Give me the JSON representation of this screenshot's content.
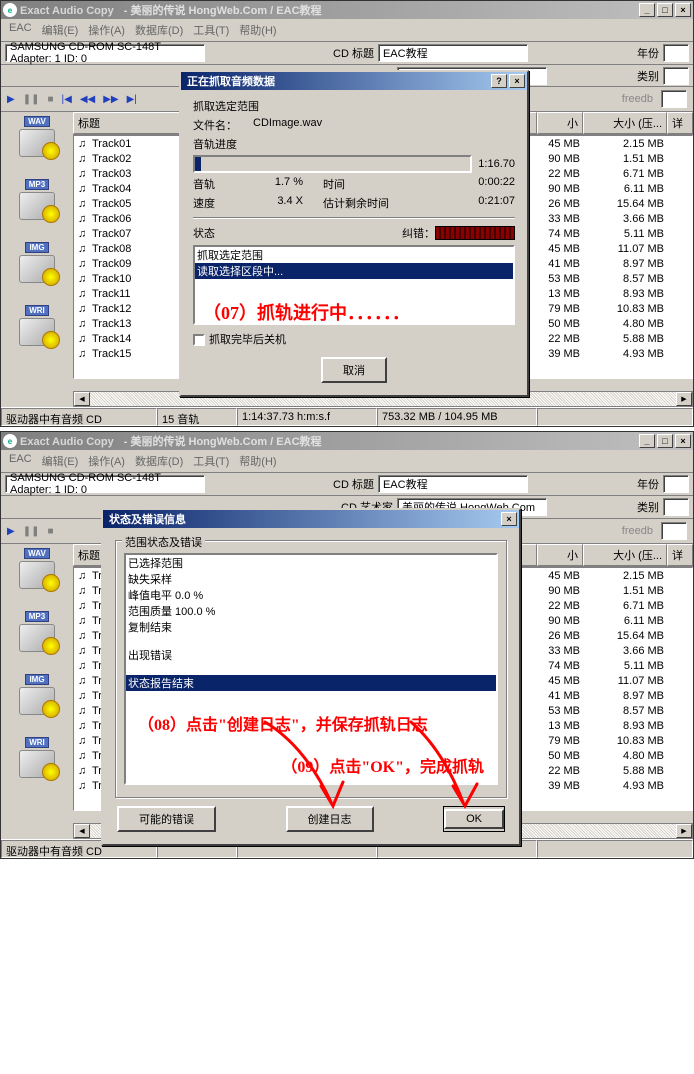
{
  "win1": {
    "title": "Exact Audio Copy",
    "subtitle": "- 美丽的传说 HongWeb.Com / EAC教程",
    "menu": [
      "EAC",
      "编辑(E)",
      "操作(A)",
      "数据库(D)",
      "工具(T)",
      "帮助(H)"
    ],
    "drive": "SAMSUNG CD-ROM SC-148T  Adapter: 1  ID: 0",
    "cd_label": "CD 标题",
    "cd_title": "EAC教程",
    "year_label": "年份",
    "artist_label": "CD 艺术家",
    "artist": "美丽的传说 HongWeb.Com",
    "genre_label": "类别",
    "freedb": "freedb",
    "side": [
      "WAV",
      "MP3",
      "IMG",
      "WRI"
    ],
    "cols_title": "标题",
    "cols_s": "小",
    "cols_size": "大小 (压...",
    "tracks": [
      {
        "t": "Track01",
        "s": "45 MB",
        "z": "2.15 MB"
      },
      {
        "t": "Track02",
        "s": "90 MB",
        "z": "1.51 MB"
      },
      {
        "t": "Track03",
        "s": "22 MB",
        "z": "6.71 MB"
      },
      {
        "t": "Track04",
        "s": "90 MB",
        "z": "6.11 MB"
      },
      {
        "t": "Track05",
        "s": "26 MB",
        "z": "15.64 MB"
      },
      {
        "t": "Track06",
        "s": "33 MB",
        "z": "3.66 MB"
      },
      {
        "t": "Track07",
        "s": "74 MB",
        "z": "5.11 MB"
      },
      {
        "t": "Track08",
        "s": "45 MB",
        "z": "11.07 MB"
      },
      {
        "t": "Track09",
        "s": "41 MB",
        "z": "8.97 MB"
      },
      {
        "t": "Track10",
        "s": "53 MB",
        "z": "8.57 MB"
      },
      {
        "t": "Track11",
        "s": "13 MB",
        "z": "8.93 MB"
      },
      {
        "t": "Track12",
        "s": "79 MB",
        "z": "10.83 MB"
      },
      {
        "t": "Track13",
        "s": "50 MB",
        "z": "4.80 MB"
      },
      {
        "t": "Track14",
        "s": "22 MB",
        "z": "5.88 MB"
      },
      {
        "t": "Track15",
        "s": "39 MB",
        "z": "4.93 MB"
      }
    ],
    "status1": "驱动器中有音频 CD",
    "status2": "15 音轨",
    "status3": "1:14:37.73 h:m:s.f",
    "status4": "753.32 MB / 104.95 MB"
  },
  "dlg1": {
    "title": "正在抓取音频数据",
    "section": "抓取选定范围",
    "file_l": "文件名：",
    "file": "CDImage.wav",
    "prog_l": "音轨进度",
    "prog_t": "1:16.70",
    "trk_l": "音轨",
    "trk_p": "1.7 %",
    "time_l": "时间",
    "time_v": "0:00:22",
    "spd_l": "速度",
    "spd_v": "3.4 X",
    "eta_l": "估计剩余时间",
    "eta_v": "0:21:07",
    "state_l": "状态",
    "err_l": "纠错：",
    "log1": "抓取选定范围",
    "log2": "读取选择区段中...",
    "anno": "（07）抓轨进行中．．．．．．",
    "shut": "抓取完毕后关机",
    "cancel": "取消"
  },
  "win2": {
    "status1": "驱动器中有音频 CD"
  },
  "dlg2": {
    "title": "状态及错误信息",
    "gtitle": "范围状态及错误",
    "l1": "已选择范围",
    "l2": "缺失采样",
    "l3": "峰值电平 0.0 %",
    "l4": "范围质量 100.0 %",
    "l5": "复制结束",
    "l6": "出现错误",
    "l7": "状态报告结束",
    "anno1": "（08）点击\"创建日志\"，并保存抓轨日志",
    "anno2": "（09）点击\"OK\"，完成抓轨",
    "btn1": "可能的错误",
    "btn2": "创建日志",
    "btn3": "OK"
  }
}
